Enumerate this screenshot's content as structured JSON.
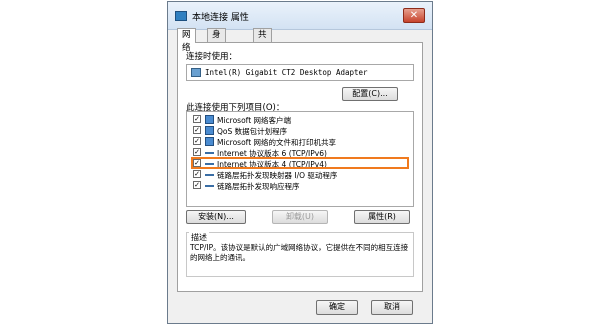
{
  "window": {
    "title": "本地连接 属性",
    "close_glyph": "✕"
  },
  "tabs": [
    "网络",
    "身份验证",
    "共享"
  ],
  "network": {
    "connect_using_label": "连接时使用：",
    "adapter_name": "Intel(R) Gigabit CT2 Desktop Adapter",
    "configure_button": "配置(C)...",
    "items_label": "此连接使用下列项目(O)：",
    "items": [
      {
        "label": "Microsoft 网络客户端",
        "checked": true,
        "icon": "network-client-icon"
      },
      {
        "label": "QoS 数据包计划程序",
        "checked": true,
        "icon": "qos-icon"
      },
      {
        "label": "Microsoft 网络的文件和打印机共享",
        "checked": true,
        "icon": "file-printer-share-icon"
      },
      {
        "label": "Internet 协议版本 6 (TCP/IPv6)",
        "checked": true,
        "icon": "protocol-icon"
      },
      {
        "label": "Internet 协议版本 4 (TCP/IPv4)",
        "checked": true,
        "icon": "protocol-icon"
      },
      {
        "label": "链路层拓扑发现映射器 I/O 驱动程序",
        "checked": true,
        "icon": "protocol-icon"
      },
      {
        "label": "链路层拓扑发现响应程序",
        "checked": true,
        "icon": "protocol-icon"
      }
    ],
    "install_button": "安装(N)...",
    "uninstall_button": "卸载(U)",
    "properties_button": "属性(R)",
    "description_title": "描述",
    "description_text": "TCP/IP。该协议是默认的广域网络协议，它提供在不同的相互连接的网络上的通讯。"
  },
  "footer": {
    "ok_button": "确定",
    "cancel_button": "取消"
  },
  "colors": {
    "highlight": "#f07a1e"
  }
}
